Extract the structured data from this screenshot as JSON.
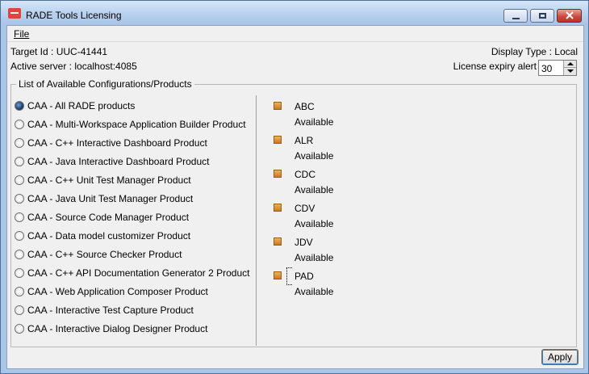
{
  "window": {
    "title": "RADE Tools Licensing"
  },
  "menu": {
    "file": "File"
  },
  "info": {
    "target_id": "Target Id : UUC-41441",
    "active_server": "Active server : localhost:4085",
    "display_type": "Display Type : Local",
    "expiry_alert_label": "License expiry alert",
    "expiry_alert_value": "30"
  },
  "group": {
    "title": "List of Available Configurations/Products"
  },
  "configurations": [
    {
      "label": "CAA - All RADE products",
      "selected": true
    },
    {
      "label": "CAA - Multi-Workspace Application Builder Product",
      "selected": false
    },
    {
      "label": "CAA - C++ Interactive Dashboard Product",
      "selected": false
    },
    {
      "label": "CAA - Java Interactive Dashboard Product",
      "selected": false
    },
    {
      "label": "CAA - C++ Unit Test Manager Product",
      "selected": false
    },
    {
      "label": "CAA - Java Unit Test Manager Product",
      "selected": false
    },
    {
      "label": "CAA - Source Code Manager Product",
      "selected": false
    },
    {
      "label": "CAA - Data model customizer Product",
      "selected": false
    },
    {
      "label": "CAA - C++ Source Checker Product",
      "selected": false
    },
    {
      "label": "CAA - C++ API Documentation Generator 2 Product",
      "selected": false
    },
    {
      "label": "CAA - Web Application Composer Product",
      "selected": false
    },
    {
      "label": "CAA - Interactive Test Capture Product",
      "selected": false
    },
    {
      "label": "CAA - Interactive Dialog Designer Product",
      "selected": false
    }
  ],
  "products": [
    {
      "name": "ABC",
      "status": "Available"
    },
    {
      "name": "ALR",
      "status": "Available"
    },
    {
      "name": "CDC",
      "status": "Available"
    },
    {
      "name": "CDV",
      "status": "Available"
    },
    {
      "name": "JDV",
      "status": "Available"
    },
    {
      "name": "PAD",
      "status": "Available"
    }
  ],
  "buttons": {
    "apply": "Apply"
  },
  "colors": {
    "titlebar": "#b9d1ee",
    "product_icon": "#e0952f",
    "radio_selected": "#1c3e74"
  }
}
